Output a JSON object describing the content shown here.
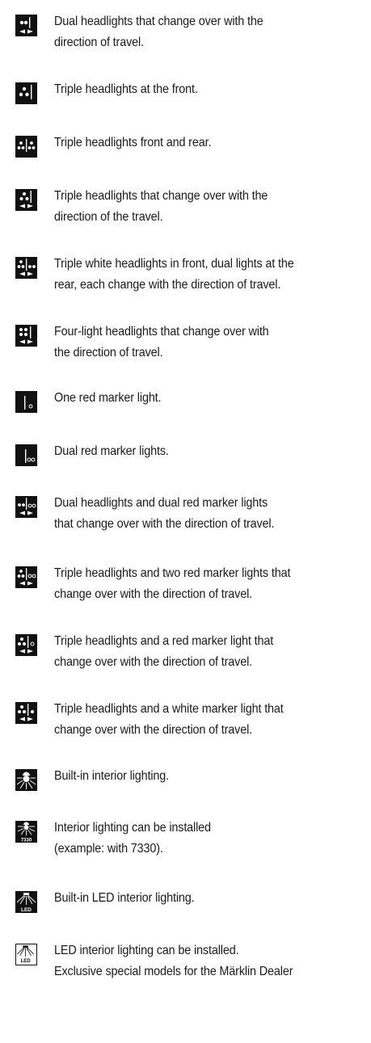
{
  "items": [
    {
      "icon": "dual-headlights-changeover-icon",
      "lines": [
        "Dual headlights that change over with the",
        "direction of travel."
      ]
    },
    {
      "icon": "triple-headlights-front-icon",
      "lines": [
        "Triple headlights at the front.",
        ""
      ]
    },
    {
      "icon": "triple-headlights-front-rear-icon",
      "lines": [
        "Triple headlights front and rear.",
        ""
      ]
    },
    {
      "icon": "triple-headlights-changeover-icon",
      "lines": [
        "Triple headlights that change over with the",
        "direction of the travel."
      ]
    },
    {
      "icon": "triple-white-dual-rear-icon",
      "lines": [
        "Triple white headlights in front, dual lights at the",
        "rear, each change with the direction of travel."
      ]
    },
    {
      "icon": "four-light-headlights-icon",
      "lines": [
        "Four-light headlights that change over with",
        "the direction of travel."
      ]
    },
    {
      "icon": "one-red-marker-icon",
      "lines": [
        "One red marker light.",
        ""
      ]
    },
    {
      "icon": "dual-red-marker-icon",
      "lines": [
        "Dual red marker lights.",
        ""
      ]
    },
    {
      "icon": "dual-headlights-dual-red-icon",
      "lines": [
        "Dual headlights and dual red marker lights",
        "that change over with the direction of travel."
      ]
    },
    {
      "icon": "triple-headlights-two-red-icon",
      "lines": [
        "Triple headlights and two red marker lights that",
        "change over with the direction of travel."
      ]
    },
    {
      "icon": "triple-headlights-red-marker-icon",
      "lines": [
        "Triple headlights and a red marker light that",
        "change over with the direction of travel."
      ]
    },
    {
      "icon": "triple-headlights-white-marker-icon",
      "lines": [
        "Triple headlights and a white marker light that",
        "change over with the direction of travel."
      ]
    },
    {
      "icon": "interior-lighting-icon",
      "lines": [
        "Built-in interior lighting.",
        ""
      ]
    },
    {
      "icon": "interior-lighting-installable-icon",
      "lines": [
        "Interior lighting can be installed",
        "(example: with 7330)."
      ]
    },
    {
      "icon": "led-interior-lighting-icon",
      "lines": [
        "Built-in LED interior lighting.",
        ""
      ]
    },
    {
      "icon": "led-interior-installable-icon",
      "lines": [
        "LED interior lighting can be installed.",
        "Exclusive special models for the Märklin Dealer"
      ]
    }
  ],
  "icon_labels": {
    "model_number": "7330",
    "led": "LED",
    "led_outline": "LED"
  }
}
